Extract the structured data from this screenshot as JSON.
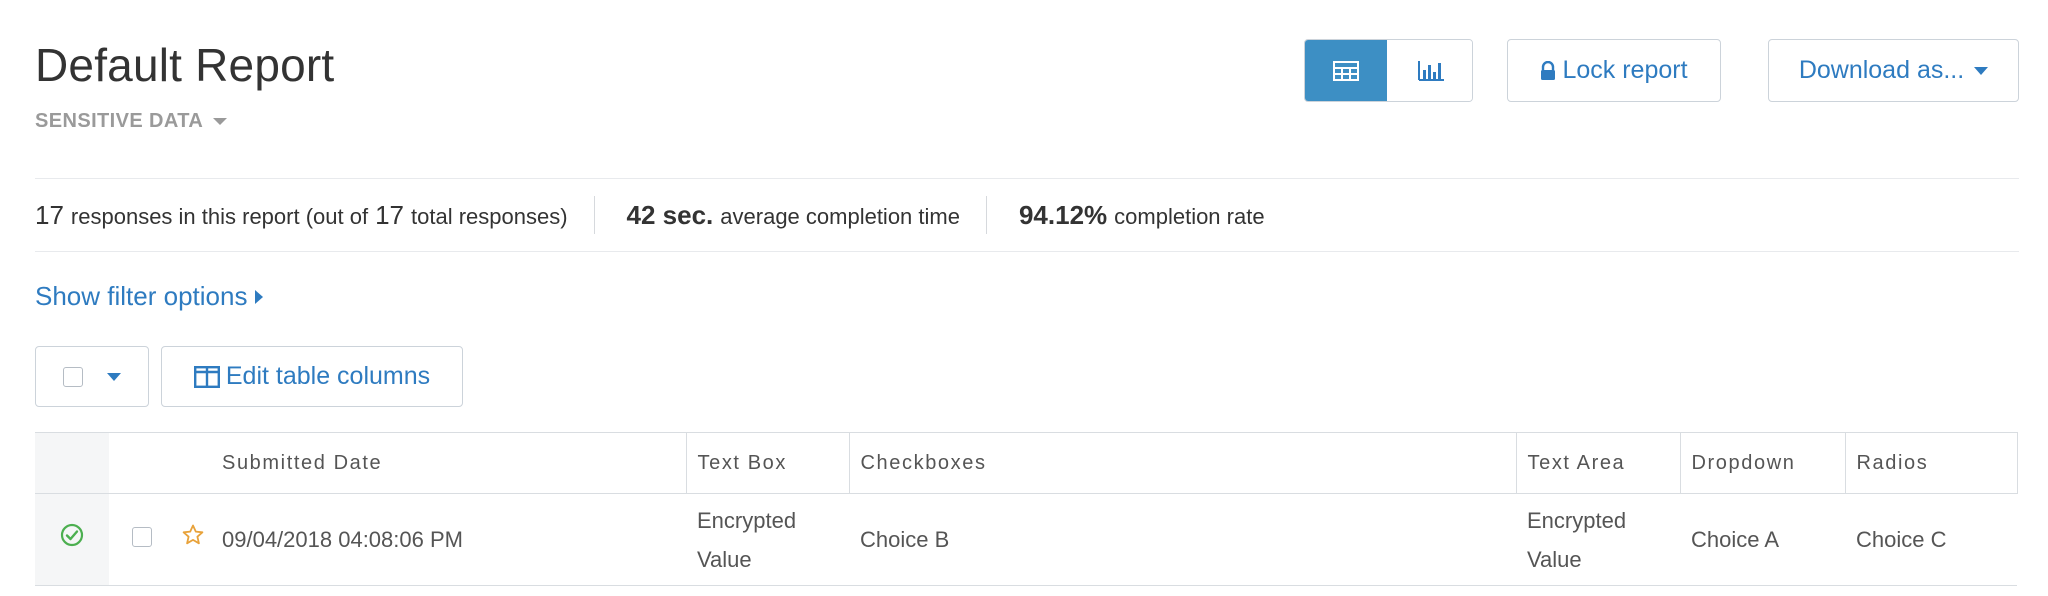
{
  "report": {
    "title": "Default Report",
    "sensitivity_label": "SENSITIVE DATA"
  },
  "toolbar": {
    "table_view_icon": "table-grid-icon",
    "chart_view_icon": "bar-chart-icon",
    "active_view": "table",
    "lock_label": "Lock report",
    "download_label": "Download as..."
  },
  "stats": {
    "responses_count": "17",
    "responses_text": "responses in this report (out of",
    "total_count": "17",
    "total_text": "total responses)",
    "avg_time_value": "42 sec.",
    "avg_time_text": "average completion time",
    "completion_rate_value": "94.12%",
    "completion_rate_text": "completion rate"
  },
  "filter": {
    "label": "Show filter options"
  },
  "table_controls": {
    "edit_columns_label": "Edit table columns"
  },
  "table": {
    "columns": [
      "Submitted Date",
      "Text Box",
      "Checkboxes",
      "Text Area",
      "Dropdown",
      "Radios"
    ],
    "rows": [
      {
        "status": "completed",
        "submitted_date": "09/04/2018 04:08:06 PM",
        "text_box": "Encrypted Value",
        "checkboxes": "Choice B",
        "text_area": "Encrypted Value",
        "dropdown": "Choice A",
        "radios": "Choice C"
      }
    ]
  },
  "colors": {
    "accent": "#2e7bc0",
    "active_toggle": "#3d8fc4",
    "success": "#4caf50",
    "star": "#e8a23a"
  }
}
